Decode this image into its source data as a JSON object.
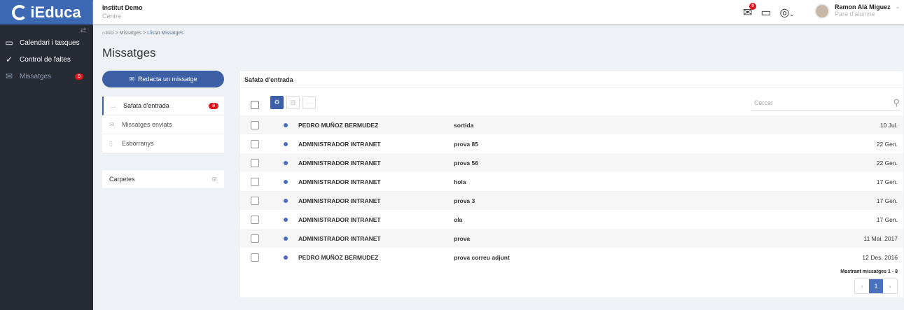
{
  "app": {
    "logo": "iEduca"
  },
  "sidebar": {
    "items": [
      {
        "label": "Calendari i tasques",
        "icon": "calendar-icon"
      },
      {
        "label": "Control de faltes",
        "icon": "check-circle-icon"
      },
      {
        "label": "Missatges",
        "icon": "envelope-icon",
        "badge": "8"
      }
    ]
  },
  "header": {
    "org": "Institut Demo",
    "org_sub": "Centre",
    "mail_badge": "0",
    "user_name": "Ramon Alá Miguez",
    "user_role": "Pare d'alumne"
  },
  "breadcrumb": {
    "home": "Inici",
    "sep1": " > ",
    "missatges": "Missatges",
    "sep2": " > ",
    "current": "Llistat Missatges"
  },
  "page_title": "Missatges",
  "compose_label": "Redacta un missatge",
  "folders": [
    {
      "label": "Safata d'entrada",
      "badge": "8"
    },
    {
      "label": "Missatges enviats"
    },
    {
      "label": "Esborranys"
    }
  ],
  "carpetes_label": "Carpetes",
  "main": {
    "title": "Safata d'entrada",
    "search_placeholder": "Cercar",
    "messages": [
      {
        "from": "PEDRO MUÑOZ BERMUDEZ",
        "subject": "sortida",
        "date": "10 Jul."
      },
      {
        "from": "ADMINISTRADOR INTRANET",
        "subject": "prova 85",
        "date": "22 Gen."
      },
      {
        "from": "ADMINISTRADOR INTRANET",
        "subject": "prova 56",
        "date": "22 Gen."
      },
      {
        "from": "ADMINISTRADOR INTRANET",
        "subject": "hola",
        "date": "17 Gen."
      },
      {
        "from": "ADMINISTRADOR INTRANET",
        "subject": "prova 3",
        "date": "17 Gen."
      },
      {
        "from": "ADMINISTRADOR INTRANET",
        "subject": "ola",
        "date": "17 Gen."
      },
      {
        "from": "ADMINISTRADOR INTRANET",
        "subject": "prova",
        "date": "11 Mai. 2017"
      },
      {
        "from": "PEDRO MUÑOZ BERMUDEZ",
        "subject": "prova correu adjunt",
        "date": "12 Des. 2016"
      }
    ],
    "pagination_info": "Mostrant missatges 1 - 8",
    "current_page": "1"
  }
}
